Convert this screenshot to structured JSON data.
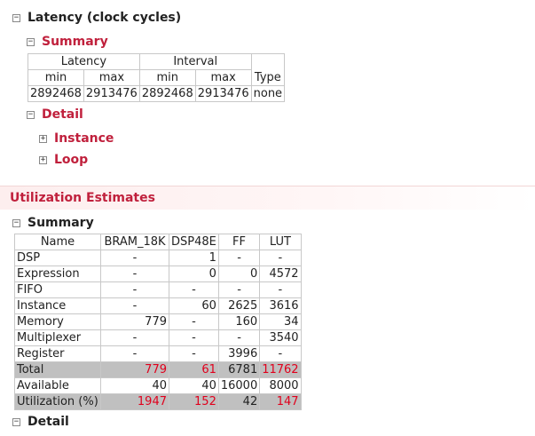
{
  "latency": {
    "title": "Latency (clock cycles)",
    "summary_label": "Summary",
    "detail_label": "Detail",
    "instance_label": "Instance",
    "loop_label": "Loop",
    "table": {
      "group_headers": [
        "Latency",
        "Interval"
      ],
      "sub_headers": [
        "min",
        "max",
        "min",
        "max",
        "Type"
      ],
      "row": [
        "2892468",
        "2913476",
        "2892468",
        "2913476",
        "none"
      ]
    }
  },
  "utilization": {
    "title": "Utilization Estimates",
    "summary_label": "Summary",
    "detail_label": "Detail",
    "table": {
      "headers": [
        "Name",
        "BRAM_18K",
        "DSP48E",
        "FF",
        "LUT"
      ],
      "rows": [
        [
          "DSP",
          "-",
          "1",
          "-",
          "-"
        ],
        [
          "Expression",
          "-",
          "0",
          "0",
          "4572"
        ],
        [
          "FIFO",
          "-",
          "-",
          "-",
          "-"
        ],
        [
          "Instance",
          "-",
          "60",
          "2625",
          "3616"
        ],
        [
          "Memory",
          "779",
          "-",
          "160",
          "34"
        ],
        [
          "Multiplexer",
          "-",
          "-",
          "-",
          "3540"
        ],
        [
          "Register",
          "-",
          "-",
          "3996",
          "-"
        ],
        [
          "Total",
          "779",
          "61",
          "6781",
          "11762"
        ],
        [
          "Available",
          "40",
          "40",
          "16000",
          "8000"
        ],
        [
          "Utilization (%)",
          "1947",
          "152",
          "42",
          "147"
        ]
      ]
    }
  },
  "icons": {
    "collapse": "⊟",
    "expand": "⊞"
  },
  "colors": {
    "heading_red": "#c0203c",
    "over_limit_red": "#e0001c",
    "total_row_bg": "#c0c0c0"
  }
}
